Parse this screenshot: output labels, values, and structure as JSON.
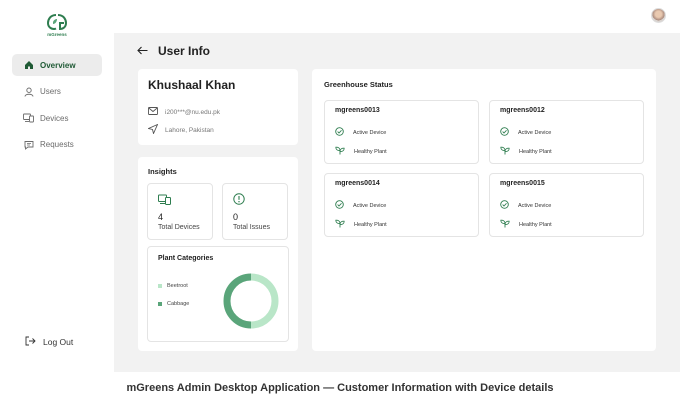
{
  "app": {
    "logo_text": "mGreens"
  },
  "sidebar": {
    "items": [
      {
        "label": "Overview",
        "icon": "home-icon",
        "active": true
      },
      {
        "label": "Users",
        "icon": "user-icon",
        "active": false
      },
      {
        "label": "Devices",
        "icon": "devices-icon",
        "active": false
      },
      {
        "label": "Requests",
        "icon": "requests-icon",
        "active": false
      }
    ],
    "logout_label": "Log Out"
  },
  "page": {
    "title": "User Info"
  },
  "user": {
    "name": "Khushaal Khan",
    "email": "i200***@nu.edu.pk",
    "location": "Lahore, Pakistan"
  },
  "insights": {
    "title": "Insights",
    "total_devices": {
      "value": "4",
      "label": "Total Devices"
    },
    "total_issues": {
      "value": "0",
      "label": "Total Issues"
    },
    "plant_categories": {
      "title": "Plant Categories",
      "items": [
        {
          "label": "Beetroot",
          "color": "#b9e6c8",
          "share": 0.5
        },
        {
          "label": "Cabbage",
          "color": "#5aa57a",
          "share": 0.5
        }
      ]
    }
  },
  "greenhouse": {
    "title": "Greenhouse Status",
    "devices": [
      {
        "name": "mgreens0013",
        "status": "Active Device",
        "plant": "Healthy Plant"
      },
      {
        "name": "mgreens0012",
        "status": "Active Device",
        "plant": "Healthy Plant"
      },
      {
        "name": "mgreens0014",
        "status": "Active Device",
        "plant": "Healthy Plant"
      },
      {
        "name": "mgreens0015",
        "status": "Active Device",
        "plant": "Healthy Plant"
      }
    ]
  },
  "caption": "mGreens Admin Desktop Application — Customer Information with Device details",
  "colors": {
    "brand": "#2e7d4f",
    "accent_dark": "#1f5a35",
    "beetroot": "#b9e6c8",
    "cabbage": "#5aa57a"
  }
}
